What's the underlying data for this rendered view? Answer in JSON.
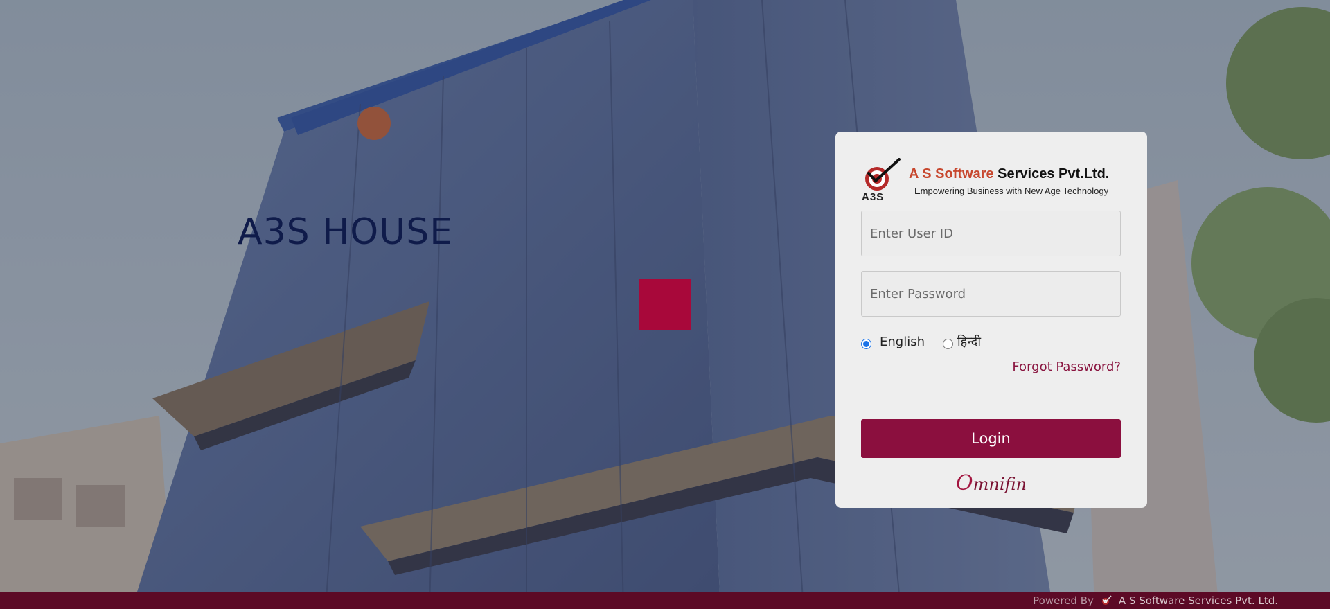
{
  "hero": {
    "title": "A3S HOUSE",
    "building_sign": "A3S HO"
  },
  "brand": {
    "logo_text": "A3S",
    "name_accent": "A S Software",
    "name_rest": " Services Pvt.Ltd.",
    "tagline": "Empowering Business with New Age Technology"
  },
  "login": {
    "user_placeholder": "Enter User ID",
    "password_placeholder": "Enter Password",
    "languages": [
      {
        "label": "English",
        "selected": true
      },
      {
        "label": "हिन्दी",
        "selected": false
      }
    ],
    "forgot_label": "Forgot Password?",
    "login_label": "Login",
    "product_initial": "O",
    "product_rest": "mnifin"
  },
  "footer": {
    "powered_label": "Powered By",
    "company": "A S Software Services Pvt. Ltd."
  },
  "colors": {
    "primary": "#8b0f3e",
    "footer": "#5c0a26",
    "loader": "#a8083a",
    "title": "#0f1b4a"
  }
}
